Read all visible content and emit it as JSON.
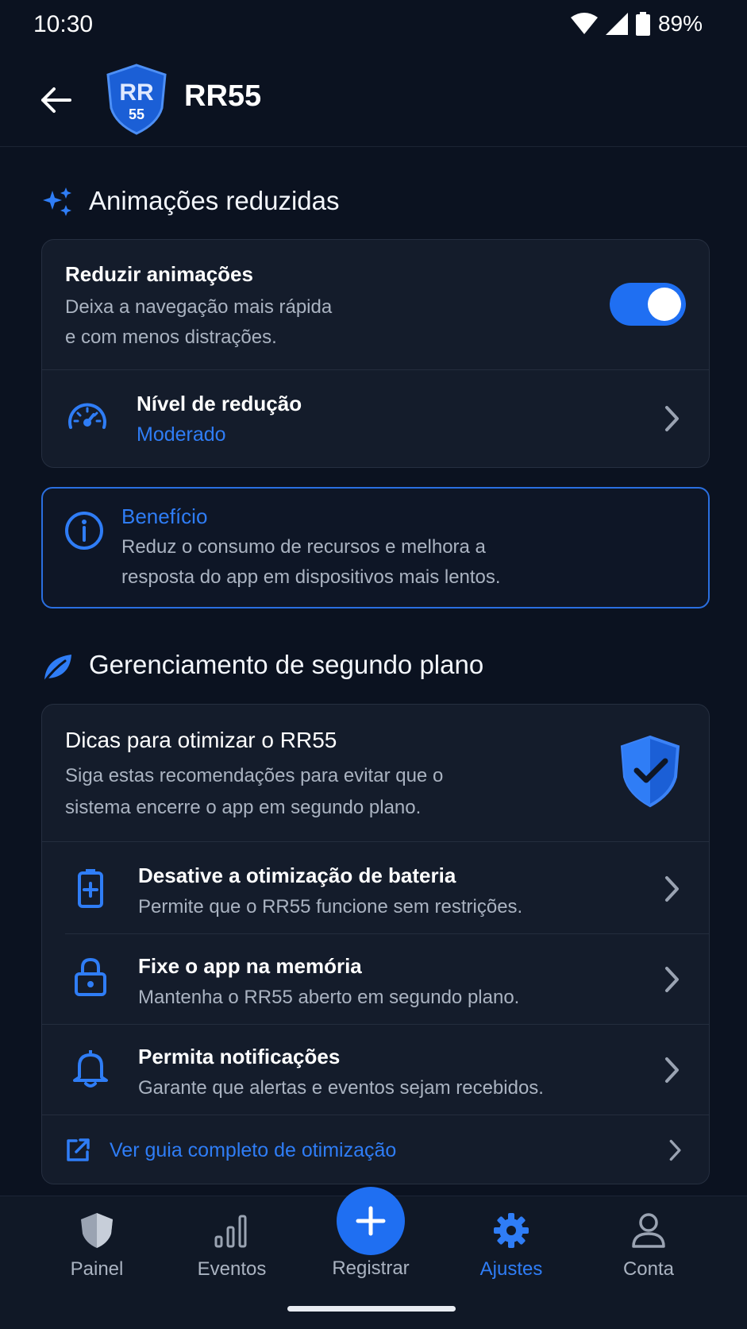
{
  "status": {
    "time": "10:30",
    "battery": "89%"
  },
  "header": {
    "title": "RR55",
    "logo_text": "RR",
    "logo_sub": "55"
  },
  "section_animations": {
    "title": "Animações reduzidas",
    "toggle_row": {
      "title": "Reduzir animações",
      "desc_line1": "Deixa a navegação mais rápida",
      "desc_line2": "e com menos distrações.",
      "enabled": true
    },
    "level_row": {
      "title": "Nível de redução",
      "value": "Moderado"
    }
  },
  "info": {
    "title": "Benefício",
    "line1": "Reduz o consumo de recursos e melhora a",
    "line2": "resposta do app em dispositivos mais lentos."
  },
  "section_background": {
    "title": "Gerenciamento de segundo plano",
    "tips": {
      "title": "Dicas para otimizar o RR55",
      "line1": "Siga estas recomendações para evitar que o",
      "line2": "sistema encerre o app em segundo plano."
    },
    "items": [
      {
        "title": "Desative a otimização de bateria",
        "desc": "Permite que o RR55 funcione sem restrições.",
        "icon": "battery-plus-icon"
      },
      {
        "title": "Fixe o app na memória",
        "desc": "Mantenha o RR55 aberto em segundo plano.",
        "icon": "lock-icon"
      },
      {
        "title": "Permita notificações",
        "desc": "Garante que alertas e eventos sejam recebidos.",
        "icon": "bell-icon"
      }
    ],
    "guide_link": "Ver guia completo de otimização"
  },
  "nav": {
    "items": [
      {
        "label": "Painel"
      },
      {
        "label": "Eventos"
      },
      {
        "label": "Registrar"
      },
      {
        "label": "Ajustes"
      },
      {
        "label": "Conta"
      }
    ],
    "active": "Ajustes"
  },
  "colors": {
    "accent": "#2f7df6",
    "background": "#0b1220",
    "card": "#141c2b"
  }
}
